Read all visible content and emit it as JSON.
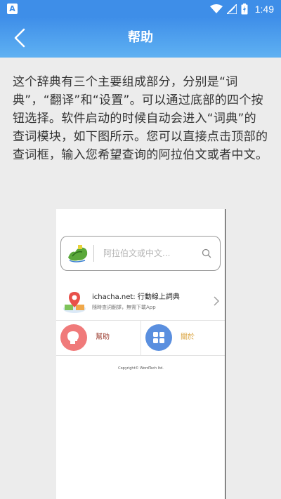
{
  "status_bar": {
    "time": "1:49",
    "left_icon_letter": "A"
  },
  "app_bar": {
    "title": "帮助",
    "back_icon": "chevron-left-icon"
  },
  "help": {
    "text": "这个辞典有三个主要组成部分，分别是“词典”，“翻译”和“设置”。可以通过底部的四个按钮选择。软件启动的时候自动会进入“词典”的查词模块，如下图所示。您可以直接点击顶部的查词框，输入您希望查询的阿拉伯文或者中文。"
  },
  "preview": {
    "search_placeholder": "阿拉伯文或中文...",
    "link_title": "ichacha.net: 行動線上詞典",
    "link_subtitle": "隨時查詞翻譯，無需下載App",
    "tiles": [
      {
        "label": "幫助",
        "color": "#f07a7a",
        "label_color": "#9b3b2e"
      },
      {
        "label": "關於",
        "color": "#5a8fdf",
        "label_color": "#d9a13a"
      }
    ],
    "copyright": "Copyright© WordTech ltd."
  },
  "colors": {
    "accent": "#3e8ee8",
    "text": "#333333"
  }
}
